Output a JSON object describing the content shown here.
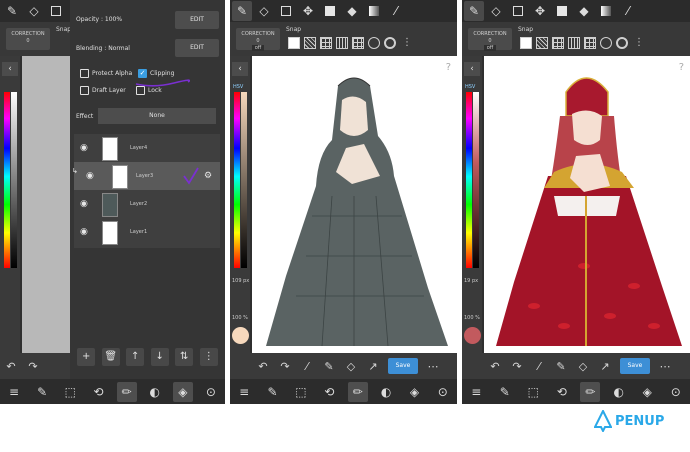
{
  "panel1": {
    "opacity_label": "Opacity : 100%",
    "edit_label_1": "EDIT",
    "blending_label": "Blending : Normal",
    "edit_label_2": "EDIT",
    "protect_alpha": "Protect Alpha",
    "clipping": "Clipping",
    "draft_layer": "Draft Layer",
    "lock": "Lock",
    "effect_label": "Effect",
    "effect_value": "None",
    "layers": [
      {
        "name": "Layer4"
      },
      {
        "name": "Layer3"
      },
      {
        "name": "Layer2"
      },
      {
        "name": "Layer1"
      }
    ],
    "correction_label": "CORRECTION\n0",
    "snap_label": "Snap"
  },
  "panel2": {
    "correction_label": "CORRECTION\n0",
    "correction_value": "off",
    "snap_label": "Snap",
    "hsv_label": "HSV",
    "brush_size": "109 px",
    "opacity": "100 %",
    "save_label": "Save",
    "swatch_color": "#f7d9bd"
  },
  "panel3": {
    "correction_label": "CORRECTION\n0",
    "correction_value": "off",
    "snap_label": "Snap",
    "hsv_label": "HSV",
    "brush_size": "19 px",
    "opacity": "100 %",
    "save_label": "Save",
    "swatch_color": "#c25a5e"
  },
  "brand": {
    "name": "PENUP",
    "color": "#2aa8e8"
  },
  "colors": {
    "panel_bg": "#2f2f2f",
    "accent": "#3d8fd6",
    "check_purple": "#7a2fd1"
  }
}
